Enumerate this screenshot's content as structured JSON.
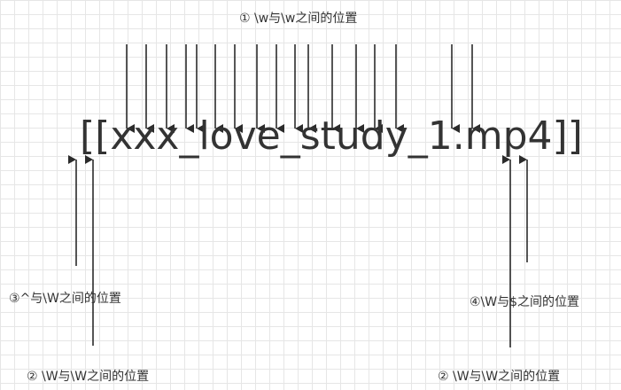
{
  "labels": {
    "word_boundaries": "① \\w与\\w之间的位置",
    "start_boundary": "③^与\\W之间的位置",
    "nonword_left": "② \\W与\\W之间的位置",
    "end_boundary": "④\\W与$之间的位置",
    "nonword_right": "② \\W与\\W之间的位置"
  },
  "sample_text": "[[xxx_love_study_1.mp4]]",
  "colors": {
    "arrow": "#2b2b2b",
    "text": "#333333",
    "grid": "#e6e6e6"
  }
}
